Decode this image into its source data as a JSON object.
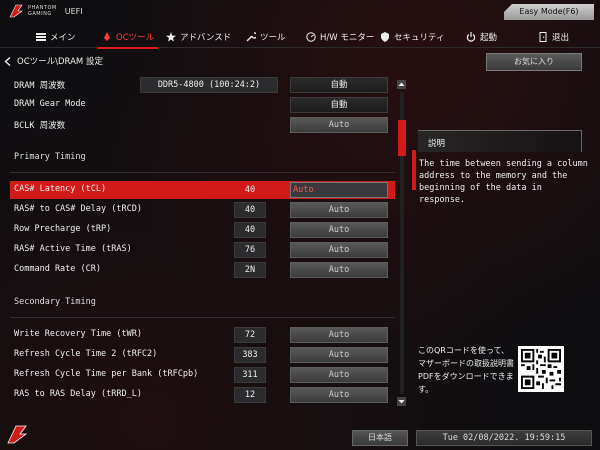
{
  "brand": {
    "line1": "PHANTOM",
    "line2": "GAMING",
    "uefi": "UEFI"
  },
  "easy_mode_button": "Easy Mode(F6)",
  "tabs": [
    {
      "label": "メイン",
      "icon": "grid-menu-icon"
    },
    {
      "label": "OCツール",
      "icon": "rocket-icon",
      "active": true
    },
    {
      "label": "アドバンスド",
      "icon": "star-icon"
    },
    {
      "label": "ツール",
      "icon": "wrench-icon"
    },
    {
      "label": "H/W モニター",
      "icon": "monitor-gauge-icon"
    },
    {
      "label": "セキュリティ",
      "icon": "shield-icon"
    },
    {
      "label": "起動",
      "icon": "power-icon"
    },
    {
      "label": "退出",
      "icon": "exit-door-icon"
    }
  ],
  "breadcrumb": "OCツール\\DRAM 設定",
  "favorite_button": "お気に入り",
  "settings": {
    "dram_freq": {
      "label": "DRAM 周波数",
      "value": "DDR5-4800 (100:24:2)",
      "option": "自動"
    },
    "gear_mode": {
      "label": "DRAM Gear Mode",
      "option": "自動"
    },
    "bclk": {
      "label": "BCLK 周波数",
      "option": "Auto"
    },
    "primary_title": "Primary Timing",
    "cas": {
      "label": "CAS# Latency (tCL)",
      "value": "40",
      "option": "Auto"
    },
    "trcd": {
      "label": "RAS# to CAS# Delay (tRCD)",
      "value": "40",
      "option": "Auto"
    },
    "trp": {
      "label": "Row Precharge (tRP)",
      "value": "40",
      "option": "Auto"
    },
    "tras": {
      "label": "RAS# Active Time (tRAS)",
      "value": "76",
      "option": "Auto"
    },
    "cr": {
      "label": "Command Rate (CR)",
      "value": "2N",
      "option": "Auto"
    },
    "secondary_title": "Secondary Timing",
    "twr": {
      "label": "Write Recovery Time (tWR)",
      "value": "72",
      "option": "Auto"
    },
    "trfc2": {
      "label": "Refresh Cycle Time 2 (tRFC2)",
      "value": "383",
      "option": "Auto"
    },
    "trfcpb": {
      "label": "Refresh Cycle Time per Bank (tRFCpb)",
      "value": "311",
      "option": "Auto"
    },
    "trrd": {
      "label": "RAS to RAS Delay (tRRD_L)",
      "value": "12",
      "option": "Auto"
    }
  },
  "help": {
    "title": "説明",
    "text": "The time between sending a column\naddress to the memory and the\nbeginning of the data in response."
  },
  "qr_text": "このQRコードを使って、マザーボードの取扱説明書PDFをダウンロードできます。",
  "language": "日本語",
  "datetime": "Tue 02/08/2022. 19:59:15",
  "colors": {
    "accent": "#d11a1a",
    "background": "#0e0e10"
  }
}
